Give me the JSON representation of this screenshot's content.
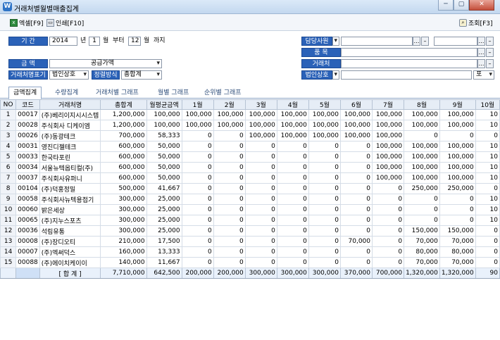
{
  "window": {
    "title": "거래처별월별매출집계",
    "app_icon": "app-logo-icon",
    "buttons": [
      "─",
      "▢",
      "✕"
    ]
  },
  "toolbar": {
    "excel_label": "엑셀[F9]",
    "print_label": "인쇄[F10]",
    "search_label": "조회[F3]"
  },
  "filters": {
    "period_label": "기  간",
    "year": "2014",
    "year_unit": "년",
    "month_from": "1",
    "month_unit": "월",
    "from_label": "부터",
    "month_to": "12",
    "until_label": "까지",
    "amount_label": "금  액",
    "amount_value": "공급가액",
    "name_display_label": "거래처명표기",
    "name_display_value": "법인상호",
    "sort_label": "정렬방식",
    "sort_value": "총합계",
    "rep_label": "담당사원",
    "item_label": "품  목",
    "client_label": "거래처",
    "corp_label": "법인상호",
    "corp_option": "포"
  },
  "tabs": [
    "금액집계",
    "수량집계",
    "거래처별 그래프",
    "월별 그래프",
    "순위별 그래프"
  ],
  "table": {
    "headers": [
      "NO",
      "코드",
      "거래처명",
      "총합계",
      "월평균금액",
      "1월",
      "2월",
      "3월",
      "4월",
      "5월",
      "6월",
      "7월",
      "8월",
      "9월",
      "10월"
    ],
    "rows": [
      [
        "1",
        "00017",
        "(주)베리이지시시스템",
        "1,200,000",
        "100,000",
        "100,000",
        "100,000",
        "100,000",
        "100,000",
        "100,000",
        "100,000",
        "100,000",
        "100,000",
        "100,000",
        "10"
      ],
      [
        "2",
        "00028",
        "주식회사 디케이엠",
        "1,200,000",
        "100,000",
        "100,000",
        "100,000",
        "100,000",
        "100,000",
        "100,000",
        "100,000",
        "100,000",
        "100,000",
        "100,000",
        "10"
      ],
      [
        "3",
        "00026",
        "(주)동광테크",
        "700,000",
        "58,333",
        "0",
        "0",
        "100,000",
        "100,000",
        "100,000",
        "100,000",
        "100,000",
        "0",
        "0",
        "0"
      ],
      [
        "4",
        "00031",
        "영진디젤테크",
        "600,000",
        "50,000",
        "0",
        "0",
        "0",
        "0",
        "0",
        "0",
        "100,000",
        "100,000",
        "100,000",
        "10"
      ],
      [
        "5",
        "00033",
        "한국타포린",
        "600,000",
        "50,000",
        "0",
        "0",
        "0",
        "0",
        "0",
        "0",
        "100,000",
        "100,000",
        "100,000",
        "10"
      ],
      [
        "6",
        "00034",
        "서울뉴텍옵티컬(주)",
        "600,000",
        "50,000",
        "0",
        "0",
        "0",
        "0",
        "0",
        "0",
        "100,000",
        "100,000",
        "100,000",
        "10"
      ],
      [
        "7",
        "00037",
        "주식회사유퍼니",
        "600,000",
        "50,000",
        "0",
        "0",
        "0",
        "0",
        "0",
        "0",
        "100,000",
        "100,000",
        "100,000",
        "10"
      ],
      [
        "8",
        "00104",
        "(주)덕홍정밀",
        "500,000",
        "41,667",
        "0",
        "0",
        "0",
        "0",
        "0",
        "0",
        "0",
        "250,000",
        "250,000",
        "0"
      ],
      [
        "9",
        "00058",
        "주식회사뉴텍용접기",
        "300,000",
        "25,000",
        "0",
        "0",
        "0",
        "0",
        "0",
        "0",
        "0",
        "0",
        "0",
        "10"
      ],
      [
        "10",
        "00060",
        "밝은세상",
        "300,000",
        "25,000",
        "0",
        "0",
        "0",
        "0",
        "0",
        "0",
        "0",
        "0",
        "0",
        "10"
      ],
      [
        "11",
        "00065",
        "(주)지누스포츠",
        "300,000",
        "25,000",
        "0",
        "0",
        "0",
        "0",
        "0",
        "0",
        "0",
        "0",
        "0",
        "10"
      ],
      [
        "12",
        "00036",
        "석림유통",
        "300,000",
        "25,000",
        "0",
        "0",
        "0",
        "0",
        "0",
        "0",
        "0",
        "150,000",
        "150,000",
        "0"
      ],
      [
        "13",
        "00008",
        "(주)장디오티",
        "210,000",
        "17,500",
        "0",
        "0",
        "0",
        "0",
        "0",
        "70,000",
        "0",
        "70,000",
        "70,000",
        "0"
      ],
      [
        "14",
        "00007",
        "(주)엑써덕스",
        "160,000",
        "13,333",
        "0",
        "0",
        "0",
        "0",
        "0",
        "0",
        "0",
        "80,000",
        "80,000",
        "0"
      ],
      [
        "15",
        "00088",
        "(주)에이치케이이",
        "140,000",
        "11,667",
        "0",
        "0",
        "0",
        "0",
        "0",
        "0",
        "0",
        "70,000",
        "70,000",
        "0"
      ]
    ],
    "total_label": "[ 합  계 ]",
    "totals": [
      "7,710,000",
      "642,500",
      "200,000",
      "200,000",
      "300,000",
      "300,000",
      "300,000",
      "370,000",
      "700,000",
      "1,320,000",
      "1,320,000",
      "90"
    ]
  }
}
